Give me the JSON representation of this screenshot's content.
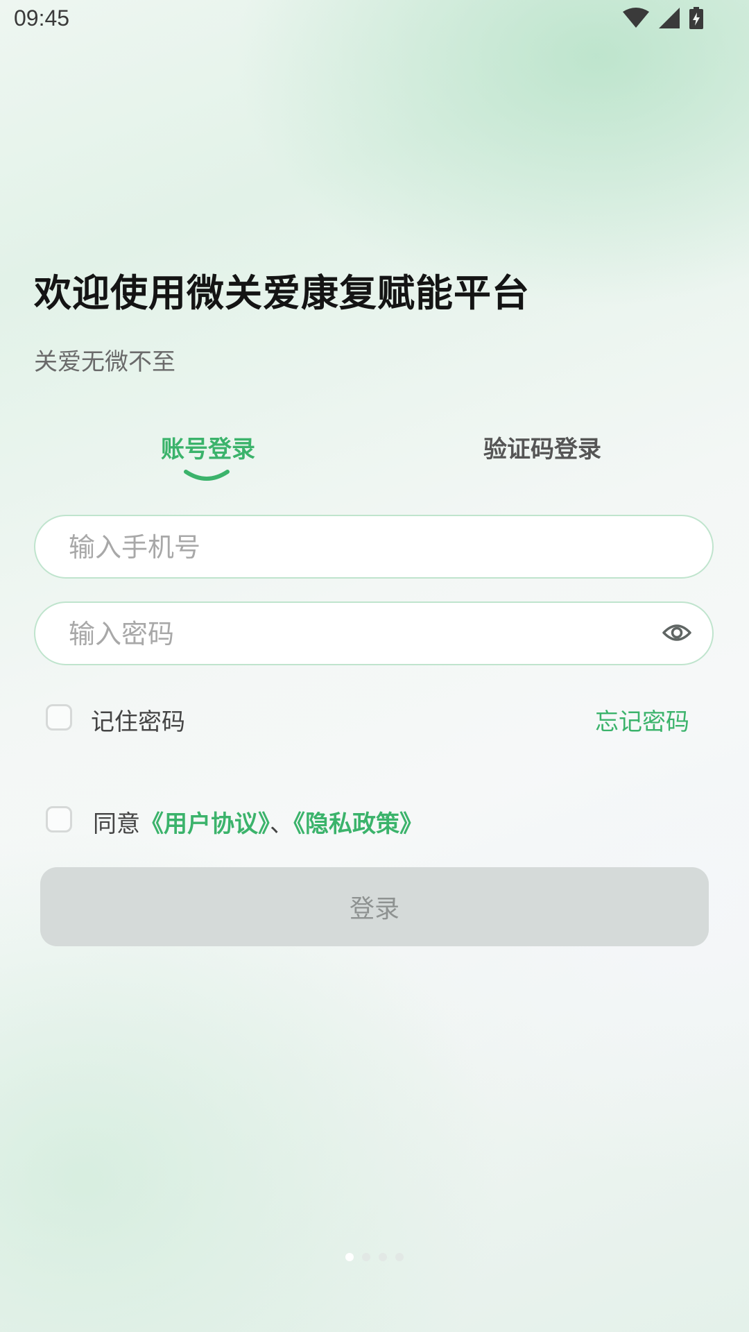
{
  "status_bar": {
    "time": "09:45",
    "icons": [
      "wifi-icon",
      "cellular-signal-icon",
      "battery-charging-icon"
    ]
  },
  "header": {
    "title": "欢迎使用微关爱康复赋能平台",
    "subtitle": "关爱无微不至"
  },
  "tabs": [
    {
      "label": "账号登录",
      "active": true
    },
    {
      "label": "验证码登录",
      "active": false
    }
  ],
  "form": {
    "phone": {
      "value": "",
      "placeholder": "输入手机号"
    },
    "password": {
      "value": "",
      "placeholder": "输入密码",
      "icon": "eye-icon"
    },
    "remember_label": "记住密码",
    "remember_checked": false,
    "forgot_label": "忘记密码",
    "agreement": {
      "checked": false,
      "prefix": "同意",
      "user_agreement": "《用户协议》",
      "separator": "、",
      "privacy_policy": "《隐私政策》"
    },
    "submit_label": "登录"
  },
  "pager": {
    "count": 4,
    "active_index": 0
  },
  "colors": {
    "accent": "#3bb36b",
    "title": "#141414",
    "button_disabled_bg": "#d5dad9",
    "button_disabled_text": "#8e9291",
    "input_border": "#bfe4cd"
  }
}
